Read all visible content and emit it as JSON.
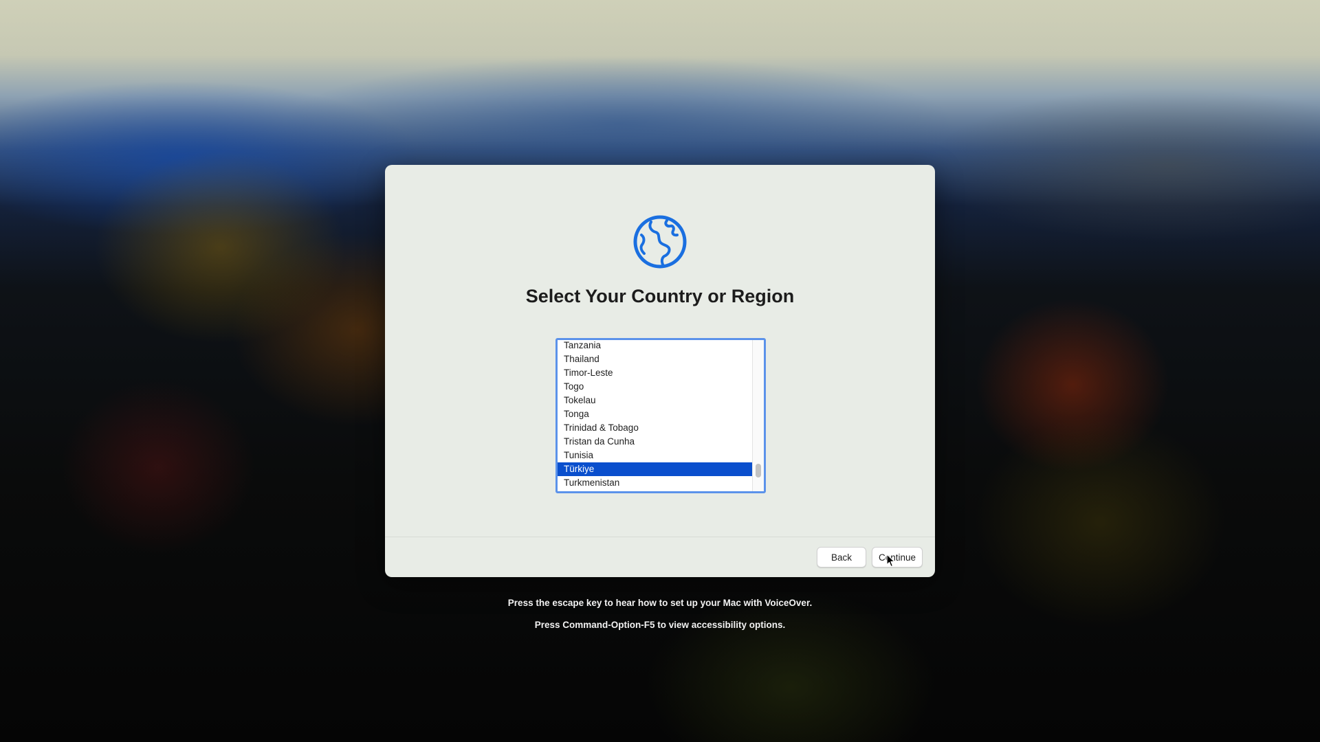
{
  "dialog": {
    "icon": "globe-icon",
    "title": "Select Your Country or Region",
    "countries": [
      "Tanzania",
      "Thailand",
      "Timor-Leste",
      "Togo",
      "Tokelau",
      "Tonga",
      "Trinidad & Tobago",
      "Tristan da Cunha",
      "Tunisia",
      "Türkiye",
      "Turkmenistan"
    ],
    "selected": "Türkiye",
    "buttons": {
      "back": "Back",
      "continue": "Continue"
    }
  },
  "hints": {
    "voiceover": "Press the escape key to hear how to set up your Mac with VoiceOver.",
    "accessibility": "Press Command-Option-F5 to view accessibility options."
  },
  "colors": {
    "accent": "#1a6fe0",
    "selection": "#0a4fcd",
    "dialog_background": "#e8ece6"
  }
}
